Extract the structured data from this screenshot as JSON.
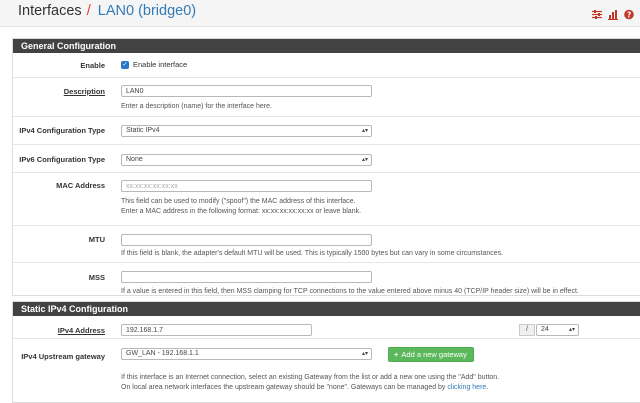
{
  "header": {
    "title": "Interfaces",
    "separator": "/",
    "subtitle": "LAN0 (bridge0)",
    "icons": [
      "sliders-icon",
      "bar-chart-icon",
      "help-icon"
    ]
  },
  "general": {
    "heading": "General Configuration",
    "enable": {
      "label": "Enable",
      "checked": true,
      "checkbox_label": "Enable interface"
    },
    "description": {
      "label": "Description",
      "value": "LAN0",
      "help": "Enter a description (name) for the interface here."
    },
    "ipv4_type": {
      "label": "IPv4 Configuration Type",
      "value": "Static IPv4"
    },
    "ipv6_type": {
      "label": "IPv6 Configuration Type",
      "value": "None"
    },
    "mac": {
      "label": "MAC Address",
      "placeholder": "xx:xx:xx:xx:xx:xx",
      "help1": "This field can be used to modify (\"spoof\") the MAC address of this interface.",
      "help2": "Enter a MAC address in the following format: xx:xx:xx:xx:xx:xx or leave blank."
    },
    "mtu": {
      "label": "MTU",
      "value": "",
      "help": "If this field is blank, the adapter's default MTU will be used. This is typically 1500 bytes but can vary in some circumstances."
    },
    "mss": {
      "label": "MSS",
      "value": "",
      "help": "If a value is entered in this field, then MSS clamping for TCP connections to the value entered above minus 40 (TCP/IP header size) will be in effect."
    }
  },
  "static_ipv4": {
    "heading": "Static IPv4 Configuration",
    "address": {
      "label": "IPv4 Address",
      "value": "192.168.1.7",
      "slash": "/",
      "cidr": "24"
    },
    "gateway": {
      "label": "IPv4 Upstream gateway",
      "value": "GW_LAN - 192.168.1.1",
      "add_button": "Add a new gateway",
      "help1": "If this interface is an Internet connection, select an existing Gateway from the list or add a new one using the \"Add\" button.",
      "help2": "On local area network interfaces the upstream gateway should be \"none\". Gateways can be managed by",
      "help_link": "clicking here",
      "help_end": "."
    }
  },
  "colors": {
    "accent": "#e83e2e",
    "link": "#337ab7",
    "panel_head": "#424242",
    "button": "#5cb85c"
  }
}
